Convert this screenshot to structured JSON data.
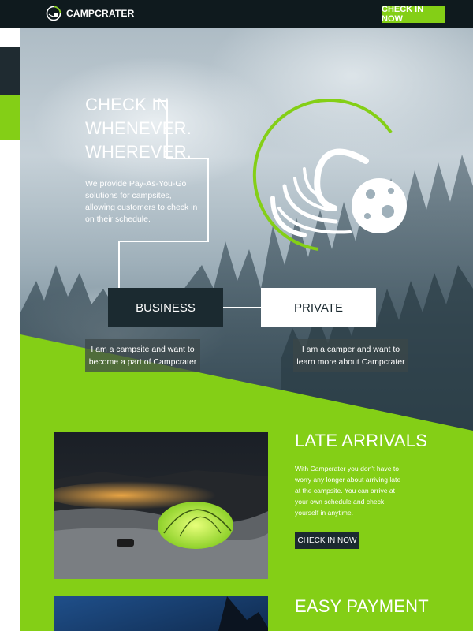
{
  "nav": {
    "brand": "CAMPCRATER",
    "cta": "CHECK IN NOW"
  },
  "hero": {
    "headline": [
      "CHECK IN",
      "WHENEVER.",
      "WHEREVER."
    ],
    "description": "We provide Pay-As-You-Go solutions for campsites, allowing customers to check in on their schedule.",
    "business_button": "BUSINESS",
    "private_button": "PRIVATE",
    "business_caption": "I am a campsite and want to become a part of Campcrater",
    "private_caption": "I am a camper and want to learn more about Campcrater"
  },
  "features": [
    {
      "title": "LATE ARRIVALS",
      "text": "With Campcrater you don't have to worry any longer about arriving late at the campsite. You can arrive at your own schedule and check yourself in anytime.",
      "button": "CHECK IN NOW"
    },
    {
      "title": "EASY PAYMENT"
    }
  ],
  "colors": {
    "accent": "#84cf16",
    "dark": "#1b2a30",
    "nav_bg": "#0f1a1e"
  }
}
